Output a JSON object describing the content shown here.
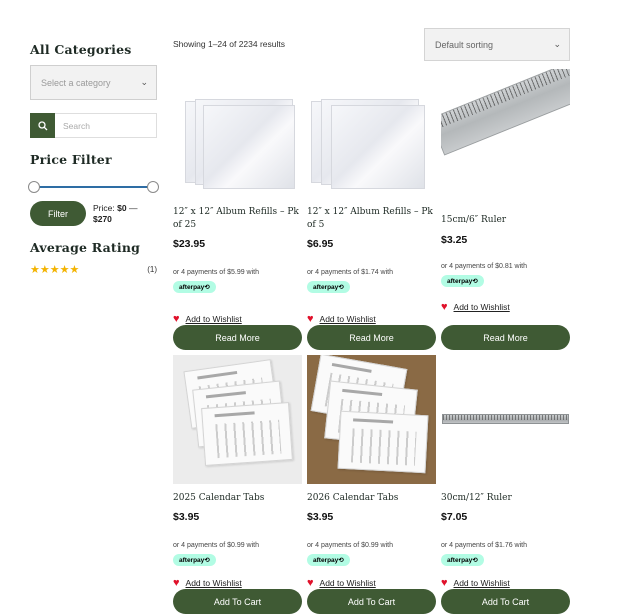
{
  "sidebar": {
    "categories_heading": "All Categories",
    "category_select_placeholder": "Select a category",
    "search_placeholder": "Search",
    "price_filter_heading": "Price Filter",
    "filter_button": "Filter",
    "price_label": "Price:",
    "price_min": "$0",
    "price_sep": "—",
    "price_max": "$270",
    "average_rating_heading": "Average Rating",
    "rating_stars": "★★★★★",
    "rating_count": "(1)"
  },
  "toolbar": {
    "results_count": "Showing 1–24 of 2234 results",
    "sorting_selected": "Default sorting"
  },
  "products": [
    {
      "name": "12″ x 12″ Album Refills – Pk of 25",
      "price": "$23.95",
      "afterpay_text": "or 4 payments of $5.99 with",
      "afterpay_badge": "afterpay⟲",
      "wishlist": "Add to Wishlist",
      "action": "Read More",
      "image": "album-refill-sleeves"
    },
    {
      "name": "12″ x 12″ Album Refills – Pk of 5",
      "price": "$6.95",
      "afterpay_text": "or 4 payments of $1.74 with",
      "afterpay_badge": "afterpay⟲",
      "wishlist": "Add to Wishlist",
      "action": "Read More",
      "image": "album-refill-sleeves"
    },
    {
      "name": "15cm/6″ Ruler",
      "price": "$3.25",
      "afterpay_text": "or 4 payments of $0.81 with",
      "afterpay_badge": "afterpay⟲",
      "wishlist": "Add to Wishlist",
      "action": "Read More",
      "image": "metal-ruler"
    },
    {
      "name": "2025 Calendar Tabs",
      "price": "$3.95",
      "afterpay_text": "or 4 payments of $0.99 with",
      "afterpay_badge": "afterpay⟲",
      "wishlist": "Add to Wishlist",
      "action": "Add To Cart",
      "image": "calendar-tabs"
    },
    {
      "name": "2026 Calendar Tabs",
      "price": "$3.95",
      "afterpay_text": "or 4 payments of $0.99 with",
      "afterpay_badge": "afterpay⟲",
      "wishlist": "Add to Wishlist",
      "action": "Add To Cart",
      "image": "calendar-tabs"
    },
    {
      "name": "30cm/12″ Ruler",
      "price": "$7.05",
      "afterpay_text": "or 4 payments of $1.76 with",
      "afterpay_badge": "afterpay⟲",
      "wishlist": "Add to Wishlist",
      "action": "Add To Cart",
      "image": "metal-ruler"
    }
  ],
  "colors": {
    "brand_green": "#3f5a34",
    "slider_blue": "#2e6da4",
    "star_gold": "#f3b300",
    "heart_red": "#e0112b",
    "afterpay_mint": "#b2fce4"
  }
}
